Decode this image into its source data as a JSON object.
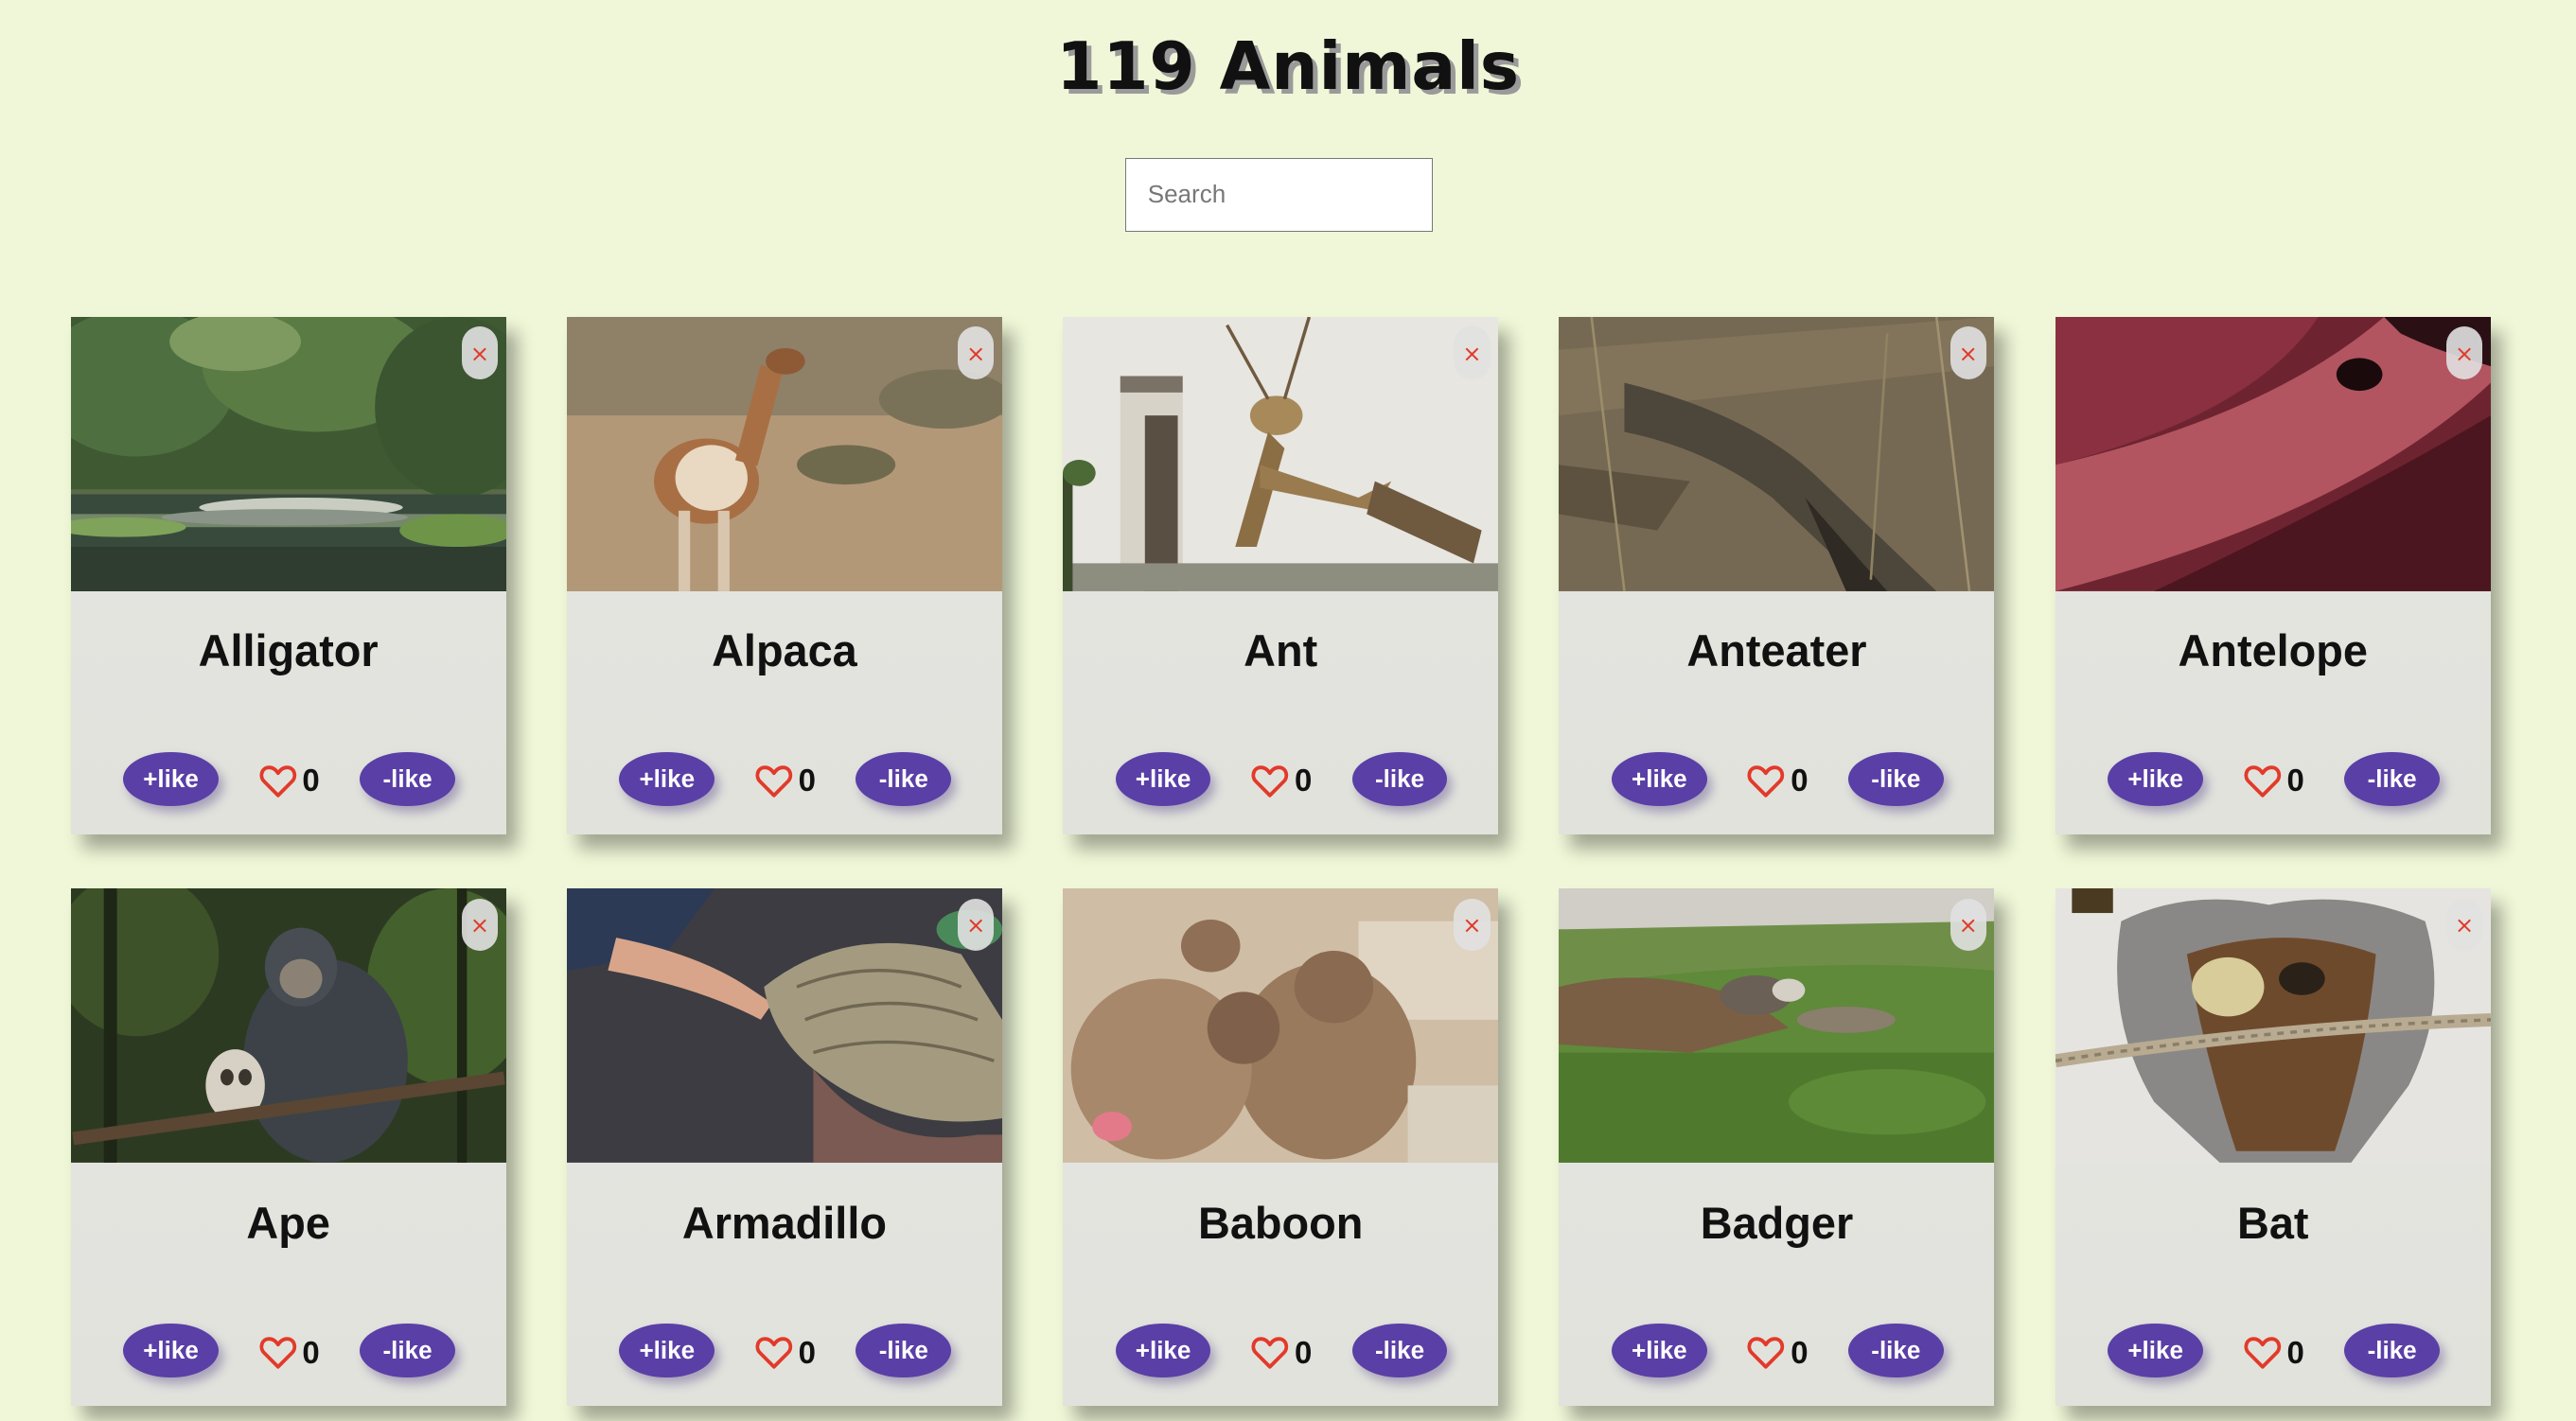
{
  "title": "119 Animals",
  "search": {
    "placeholder": "Search"
  },
  "buttons": {
    "like": "+like",
    "unlike": "-like"
  },
  "close_symbol": "×",
  "cards": [
    {
      "name": "Alligator",
      "likes": "0"
    },
    {
      "name": "Alpaca",
      "likes": "0"
    },
    {
      "name": "Ant",
      "likes": "0"
    },
    {
      "name": "Anteater",
      "likes": "0"
    },
    {
      "name": "Antelope",
      "likes": "0"
    },
    {
      "name": "Ape",
      "likes": "0"
    },
    {
      "name": "Armadillo",
      "likes": "0"
    },
    {
      "name": "Baboon",
      "likes": "0"
    },
    {
      "name": "Badger",
      "likes": "0"
    },
    {
      "name": "Bat",
      "likes": "0"
    }
  ],
  "colors": {
    "background": "#eff7d8",
    "button": "#5a3fa6",
    "heart": "#e23a2a",
    "close": "#e23a2a"
  }
}
